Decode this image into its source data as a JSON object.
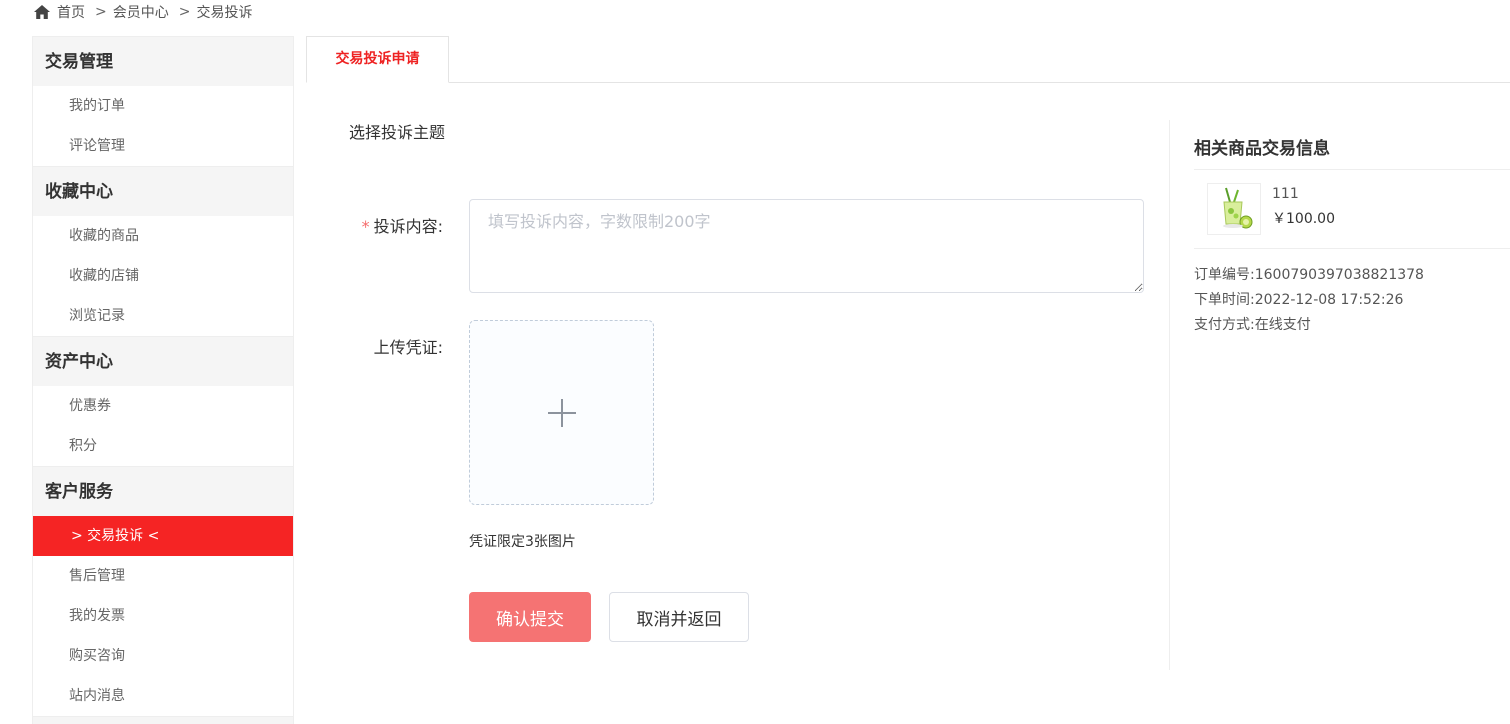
{
  "breadcrumb": {
    "home": "首页",
    "sep": ">",
    "member": "会员中心",
    "current": "交易投诉"
  },
  "sidebar": {
    "groups": [
      {
        "title": "交易管理",
        "items": [
          "我的订单",
          "评论管理"
        ]
      },
      {
        "title": "收藏中心",
        "items": [
          "收藏的商品",
          "收藏的店铺",
          "浏览记录"
        ]
      },
      {
        "title": "资产中心",
        "items": [
          "优惠券",
          "积分"
        ]
      },
      {
        "title": "客户服务",
        "items": [
          "> 交易投诉 <",
          "售后管理",
          "我的发票",
          "购买咨询",
          "站内消息"
        ]
      }
    ],
    "active_color": "#f52424"
  },
  "tabs": {
    "active": "交易投诉申请"
  },
  "form": {
    "section_title": "选择投诉主题",
    "content_label": "投诉内容:",
    "required_mark": "*",
    "content_placeholder": "填写投诉内容，字数限制200字",
    "content_value": "",
    "upload_label": "上传凭证:",
    "upload_icon": "plus-icon",
    "upload_tip": "凭证限定3张图片",
    "submit_label": "确认提交",
    "cancel_label": "取消并返回",
    "submit_color": "#f56c6c"
  },
  "order_info": {
    "title": "相关商品交易信息",
    "goods_name": "111",
    "goods_price": "￥100.00",
    "order_no_label": "订单编号:",
    "order_no": "1600790397038821378",
    "order_time_label": "下单时间:",
    "order_time": "2022-12-08 17:52:26",
    "pay_method_label": "支付方式:",
    "pay_method": "在线支付"
  }
}
